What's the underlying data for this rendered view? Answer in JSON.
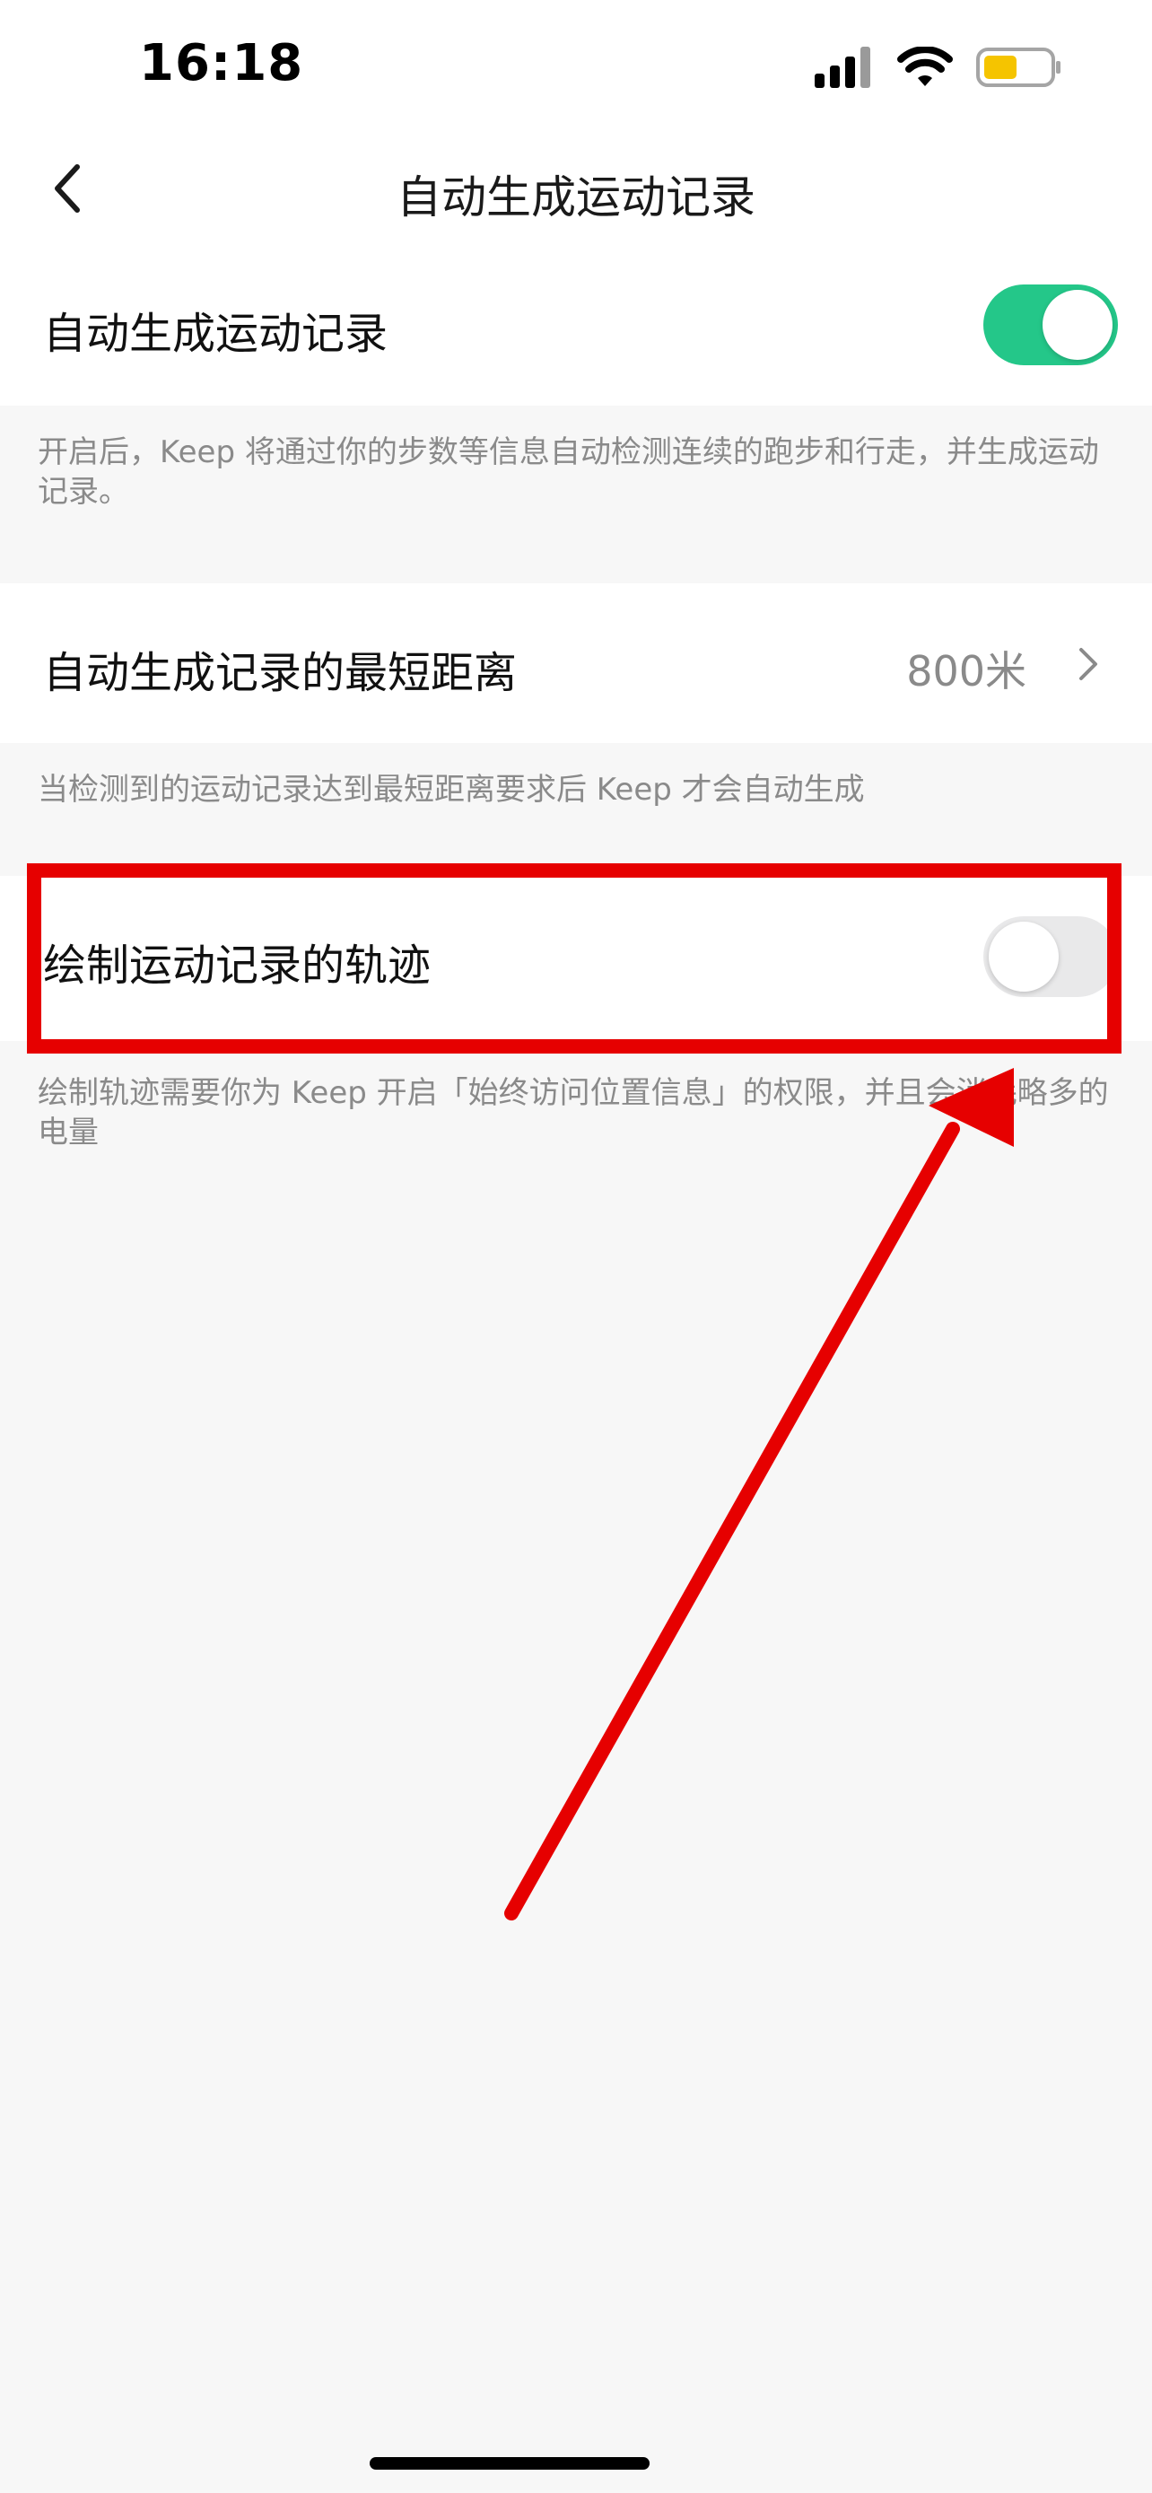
{
  "status_bar": {
    "time": "16:18",
    "icons": [
      "cellular-signal-icon",
      "wifi-icon",
      "battery-icon"
    ],
    "battery_color": "#f5c400"
  },
  "nav": {
    "back_icon": "chevron-left-icon",
    "title": "自动生成运动记录"
  },
  "settings": {
    "auto_record": {
      "label": "自动生成运动记录",
      "enabled": true,
      "description": "开启后，Keep 将通过你的步数等信息自动检测连续的跑步和行走，并生成运动记录。"
    },
    "min_distance": {
      "label": "自动生成记录的最短距离",
      "value": "800米",
      "description": "当检测到的运动记录达到最短距离要求后 Keep 才会自动生成"
    },
    "draw_track": {
      "label": "绘制运动记录的轨迹",
      "enabled": false,
      "description": "绘制轨迹需要你为 Keep 开启「始终访问位置信息」的权限，并且会消耗略多的电量"
    }
  },
  "colors": {
    "accent": "#24c789",
    "annotation": "#e60000",
    "secondary_text": "#8a8a8a"
  }
}
